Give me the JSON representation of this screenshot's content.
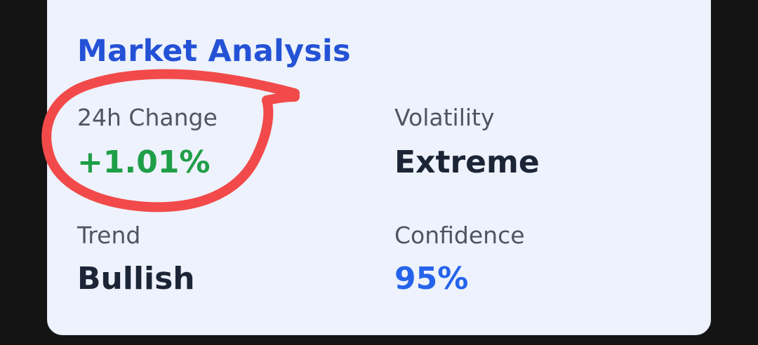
{
  "card": {
    "title": "Market Analysis"
  },
  "metrics": [
    {
      "label": "24h Change",
      "value": "+1.01%"
    },
    {
      "label": "Volatility",
      "value": "Extreme"
    },
    {
      "label": "Trend",
      "value": "Bullish"
    },
    {
      "label": "Confidence",
      "value": "95%"
    }
  ],
  "colors": {
    "page_background": "#141414",
    "card_background": "#edf2fc",
    "title": "#2452d6",
    "positive": "#1f9e48",
    "confidence": "#2563eb",
    "annotation": "#f24a4a"
  },
  "annotation": {
    "type": "hand-drawn circle",
    "target": "24h Change metric"
  }
}
